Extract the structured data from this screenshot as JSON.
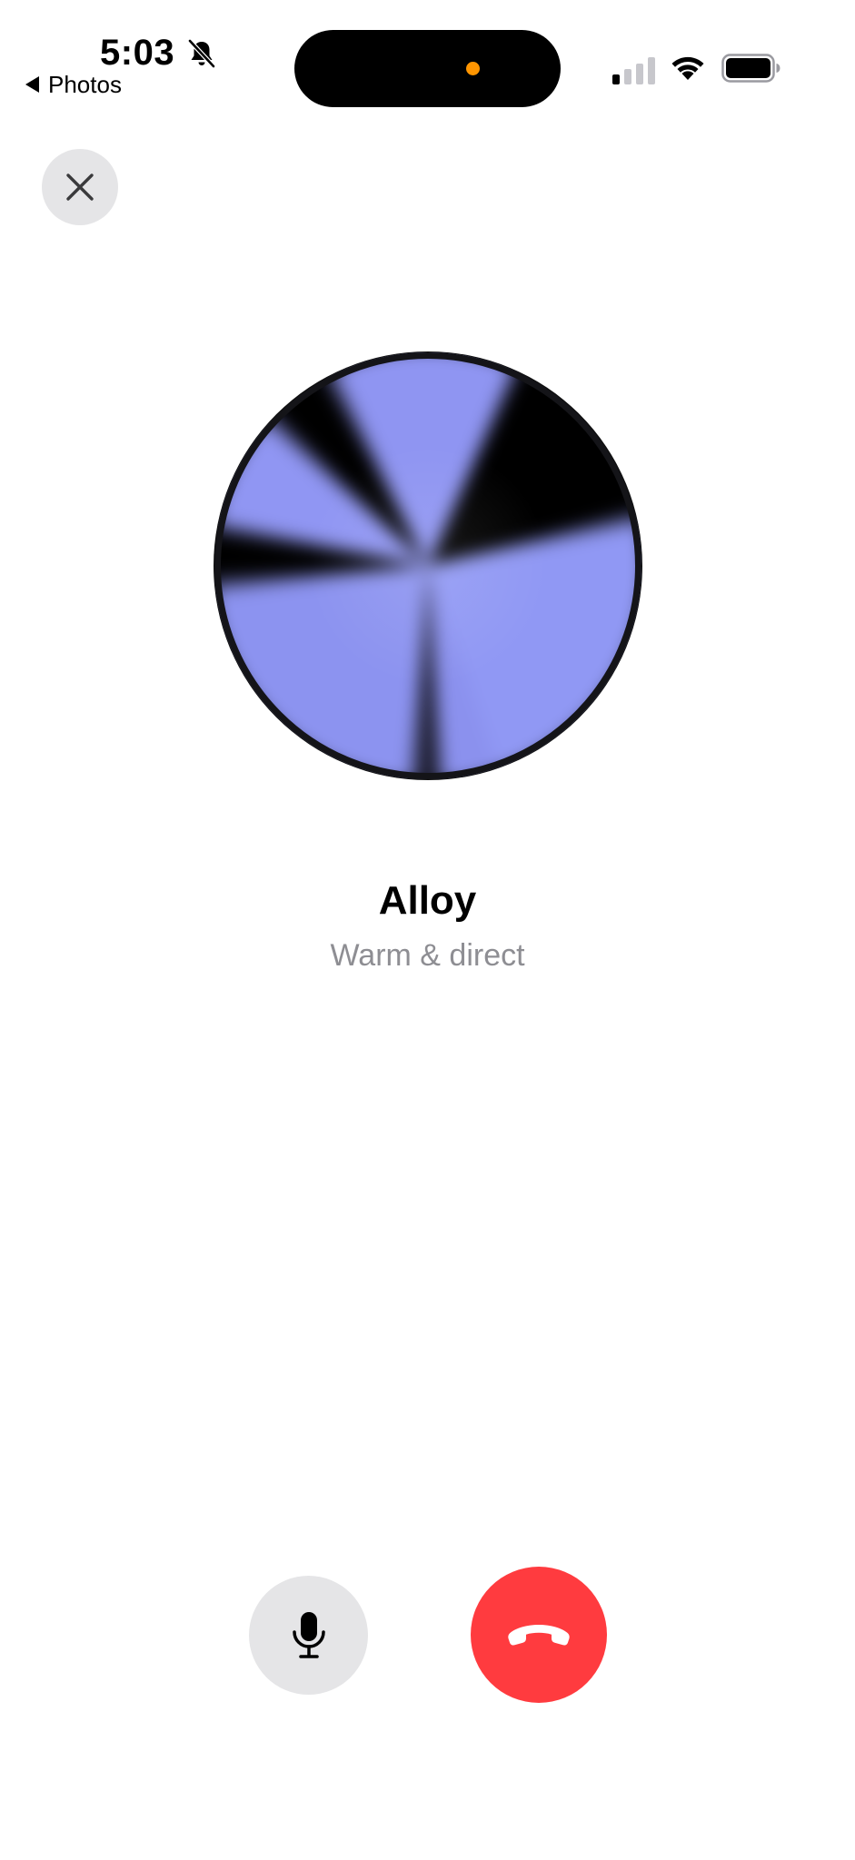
{
  "status_bar": {
    "time": "5:03",
    "back_label": "Photos",
    "icons": {
      "silent": "bell-slash-icon",
      "signal": "cellular-signal-icon",
      "wifi": "wifi-icon",
      "battery": "battery-icon"
    },
    "signal_bars_active": 1,
    "signal_bars_total": 4,
    "privacy_indicator_color": "#ff9500"
  },
  "close_button": {
    "icon": "close-icon"
  },
  "voice": {
    "name": "Alloy",
    "description": "Warm & direct",
    "orb_color": "#8f95f2"
  },
  "controls": {
    "mic_icon": "microphone-icon",
    "end_call_icon": "end-call-icon",
    "end_call_color": "#ff3b3f"
  }
}
